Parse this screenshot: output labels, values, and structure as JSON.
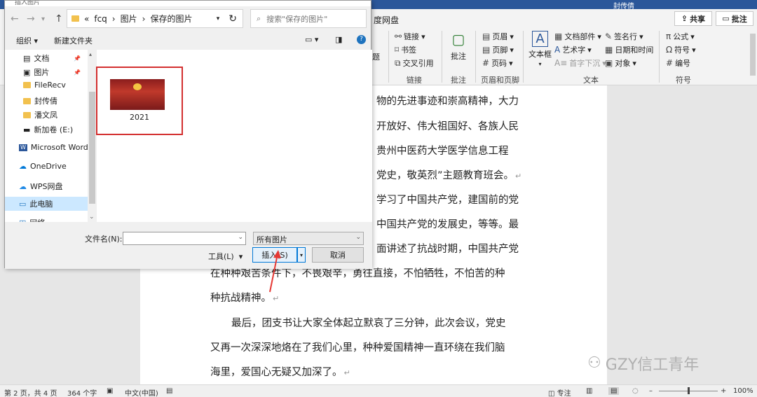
{
  "window": {
    "user_name": "封传倩"
  },
  "ribbon_tabs": {
    "baidu": "度网盘",
    "share": "共享",
    "comment": "批注"
  },
  "ribbon": {
    "link": "链接",
    "bookmark": "书签",
    "crossref": "交叉引用",
    "group_link": "链接",
    "comment_btn": "批注",
    "group_comment": "批注",
    "header": "页眉",
    "footer": "页脚",
    "pagenum": "页码",
    "group_hf": "页眉和页脚",
    "textbox": "文本框",
    "parts": "文档部件",
    "wordart": "艺术字",
    "dropcap": "首字下沉",
    "signature": "签名行",
    "datetime": "日期和时间",
    "object": "对象",
    "group_text": "文本",
    "formula": "公式",
    "symbol": "符号",
    "numbering": "编号",
    "group_symbol": "符号",
    "partial_label": "题"
  },
  "document": {
    "lines": [
      "物的先进事迹和崇高精神，大力",
      "开放好、伟大祖国好、各族人民",
      "贵州中医药大学医学信息工程",
      "党史，敬英烈”主题教育班会。",
      "学习了中国共产党，建国前的党",
      "中国共产党的发展史，等等。最",
      "面讲述了抗战时期，中国共产党",
      "在种种艰苦条件下，不畏艰辛，勇往直接，不怕牺牲，不怕苦的种",
      "种抗战精神。",
      "最后，团支书让大家全体起立默哀了三分钟，此次会议，党史",
      "又再一次深深地烙在了我们心里，种种爱国精神一直环绕在我们脑",
      "海里，爱国心无疑又加深了。"
    ],
    "paragraph_mark": "↵"
  },
  "watermark": "GZY信工青年",
  "status": {
    "page": "第 2 页，共 4 页",
    "words": "364 个字",
    "lang": "中文(中国)",
    "focus": "专注",
    "zoom": "100%"
  },
  "dialog": {
    "title": "插入图片",
    "address": {
      "root": "«",
      "parts": [
        "fcq",
        "图片",
        "保存的图片"
      ]
    },
    "search_placeholder": "搜索\"保存的图片\"",
    "organize": "组织 ▾",
    "new_folder": "新建文件夹",
    "nav_items": [
      "文档",
      "图片",
      "FileRecv",
      "封传倩",
      "潘文凤",
      "新加卷 (E:)",
      "Microsoft Word",
      "OneDrive",
      "WPS网盘",
      "此电脑",
      "网络"
    ],
    "file": {
      "name": "2021"
    },
    "filename_label": "文件名(N):",
    "filename_value": "",
    "filetype": "所有图片",
    "tools": "工具(L)",
    "insert": "插入(S)",
    "cancel": "取消"
  }
}
